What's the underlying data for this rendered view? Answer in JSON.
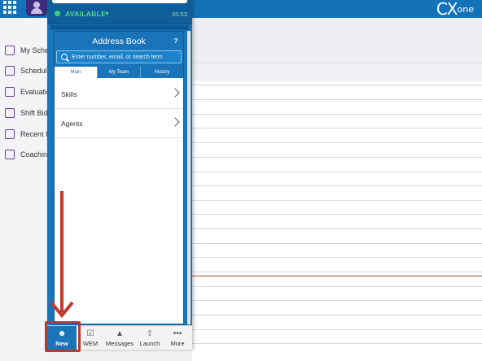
{
  "header": {
    "logo_main": "CX",
    "logo_sub": "one"
  },
  "leftnav": {
    "items": [
      {
        "label": "My Sched"
      },
      {
        "label": "Schedule"
      },
      {
        "label": "Evaluation"
      },
      {
        "label": "Shift Biddi"
      },
      {
        "label": "Recent In"
      },
      {
        "label": "Coaching"
      }
    ]
  },
  "agent": {
    "status": "AVAILABLE",
    "timer": "00:53"
  },
  "address_book": {
    "title": "Address Book",
    "help": "?",
    "search_placeholder": "Enter number, email, or search term",
    "tabs": [
      {
        "label": "Main"
      },
      {
        "label": "My Team"
      },
      {
        "label": "History"
      }
    ],
    "rows": [
      {
        "label": "Skills"
      },
      {
        "label": "Agents"
      }
    ]
  },
  "bottom_nav": {
    "items": [
      {
        "label": "New"
      },
      {
        "label": "WEM"
      },
      {
        "label": "Messages"
      },
      {
        "label": "Launch"
      },
      {
        "label": "More"
      }
    ]
  },
  "colors": {
    "brand_blue": "#1a74b9",
    "annotation_red": "#c0392b",
    "status_green": "#56d88e"
  }
}
